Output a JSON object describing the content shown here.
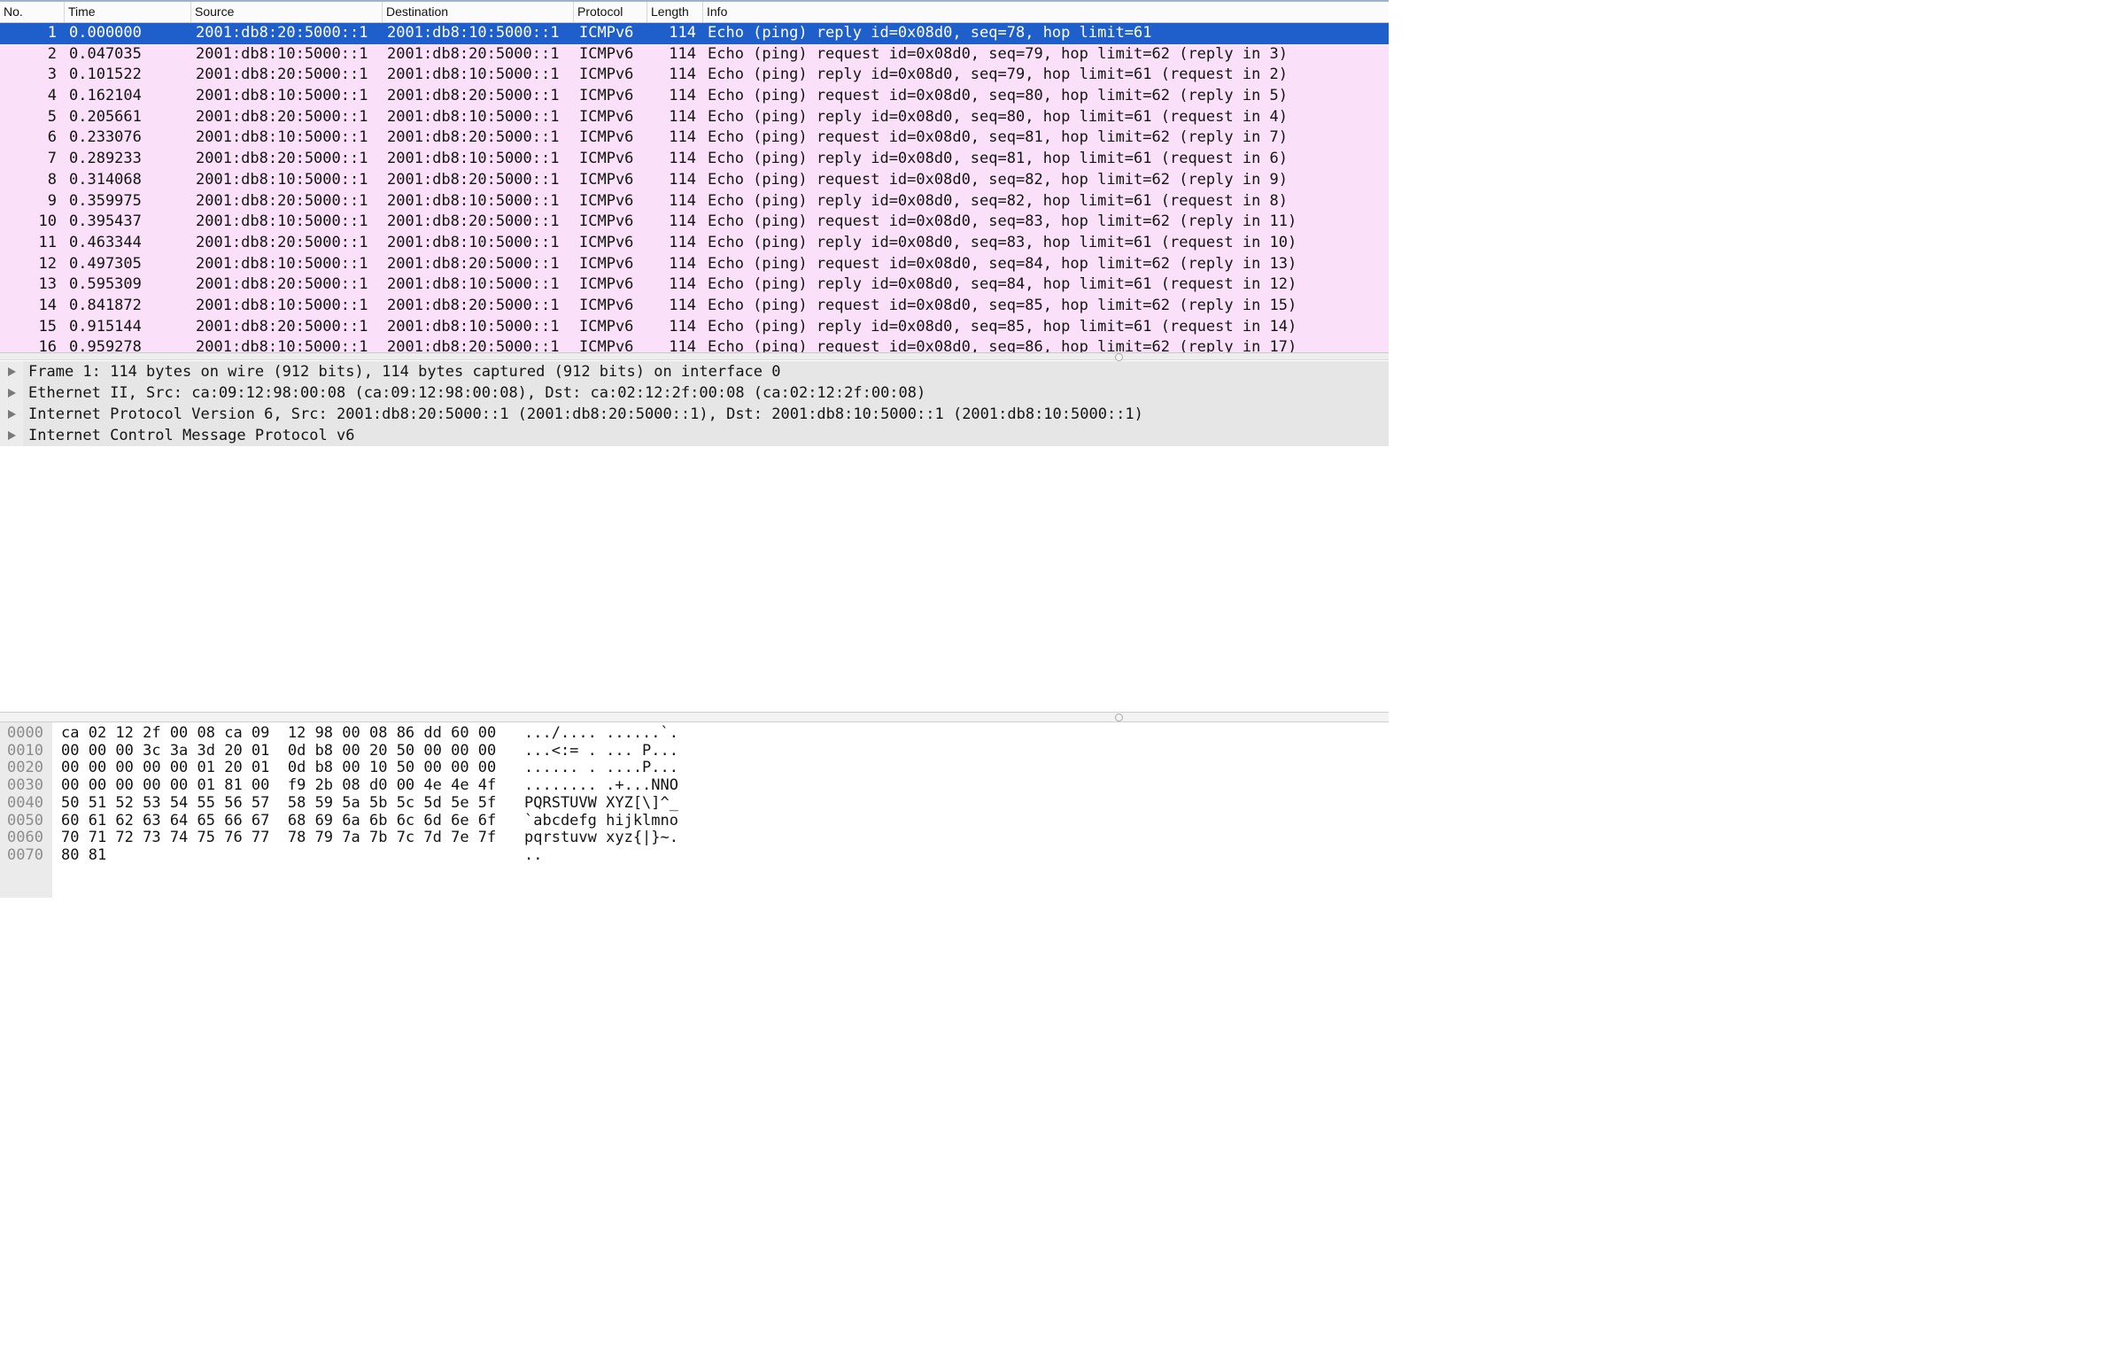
{
  "columns": {
    "no": "No.",
    "time": "Time",
    "source": "Source",
    "destination": "Destination",
    "protocol": "Protocol",
    "length": "Length",
    "info": "Info"
  },
  "packets": [
    {
      "no": "1",
      "time": "0.000000",
      "src": "2001:db8:20:5000::1",
      "dst": "2001:db8:10:5000::1",
      "proto": "ICMPv6",
      "len": "114",
      "info": "Echo (ping) reply id=0x08d0, seq=78, hop limit=61"
    },
    {
      "no": "2",
      "time": "0.047035",
      "src": "2001:db8:10:5000::1",
      "dst": "2001:db8:20:5000::1",
      "proto": "ICMPv6",
      "len": "114",
      "info": "Echo (ping) request id=0x08d0, seq=79, hop limit=62 (reply in 3)"
    },
    {
      "no": "3",
      "time": "0.101522",
      "src": "2001:db8:20:5000::1",
      "dst": "2001:db8:10:5000::1",
      "proto": "ICMPv6",
      "len": "114",
      "info": "Echo (ping) reply id=0x08d0, seq=79, hop limit=61 (request in 2)"
    },
    {
      "no": "4",
      "time": "0.162104",
      "src": "2001:db8:10:5000::1",
      "dst": "2001:db8:20:5000::1",
      "proto": "ICMPv6",
      "len": "114",
      "info": "Echo (ping) request id=0x08d0, seq=80, hop limit=62 (reply in 5)"
    },
    {
      "no": "5",
      "time": "0.205661",
      "src": "2001:db8:20:5000::1",
      "dst": "2001:db8:10:5000::1",
      "proto": "ICMPv6",
      "len": "114",
      "info": "Echo (ping) reply id=0x08d0, seq=80, hop limit=61 (request in 4)"
    },
    {
      "no": "6",
      "time": "0.233076",
      "src": "2001:db8:10:5000::1",
      "dst": "2001:db8:20:5000::1",
      "proto": "ICMPv6",
      "len": "114",
      "info": "Echo (ping) request id=0x08d0, seq=81, hop limit=62 (reply in 7)"
    },
    {
      "no": "7",
      "time": "0.289233",
      "src": "2001:db8:20:5000::1",
      "dst": "2001:db8:10:5000::1",
      "proto": "ICMPv6",
      "len": "114",
      "info": "Echo (ping) reply id=0x08d0, seq=81, hop limit=61 (request in 6)"
    },
    {
      "no": "8",
      "time": "0.314068",
      "src": "2001:db8:10:5000::1",
      "dst": "2001:db8:20:5000::1",
      "proto": "ICMPv6",
      "len": "114",
      "info": "Echo (ping) request id=0x08d0, seq=82, hop limit=62 (reply in 9)"
    },
    {
      "no": "9",
      "time": "0.359975",
      "src": "2001:db8:20:5000::1",
      "dst": "2001:db8:10:5000::1",
      "proto": "ICMPv6",
      "len": "114",
      "info": "Echo (ping) reply id=0x08d0, seq=82, hop limit=61 (request in 8)"
    },
    {
      "no": "10",
      "time": "0.395437",
      "src": "2001:db8:10:5000::1",
      "dst": "2001:db8:20:5000::1",
      "proto": "ICMPv6",
      "len": "114",
      "info": "Echo (ping) request id=0x08d0, seq=83, hop limit=62 (reply in 11)"
    },
    {
      "no": "11",
      "time": "0.463344",
      "src": "2001:db8:20:5000::1",
      "dst": "2001:db8:10:5000::1",
      "proto": "ICMPv6",
      "len": "114",
      "info": "Echo (ping) reply id=0x08d0, seq=83, hop limit=61 (request in 10)"
    },
    {
      "no": "12",
      "time": "0.497305",
      "src": "2001:db8:10:5000::1",
      "dst": "2001:db8:20:5000::1",
      "proto": "ICMPv6",
      "len": "114",
      "info": "Echo (ping) request id=0x08d0, seq=84, hop limit=62 (reply in 13)"
    },
    {
      "no": "13",
      "time": "0.595309",
      "src": "2001:db8:20:5000::1",
      "dst": "2001:db8:10:5000::1",
      "proto": "ICMPv6",
      "len": "114",
      "info": "Echo (ping) reply id=0x08d0, seq=84, hop limit=61 (request in 12)"
    },
    {
      "no": "14",
      "time": "0.841872",
      "src": "2001:db8:10:5000::1",
      "dst": "2001:db8:20:5000::1",
      "proto": "ICMPv6",
      "len": "114",
      "info": "Echo (ping) request id=0x08d0, seq=85, hop limit=62 (reply in 15)"
    },
    {
      "no": "15",
      "time": "0.915144",
      "src": "2001:db8:20:5000::1",
      "dst": "2001:db8:10:5000::1",
      "proto": "ICMPv6",
      "len": "114",
      "info": "Echo (ping) reply id=0x08d0, seq=85, hop limit=61 (request in 14)"
    },
    {
      "no": "16",
      "time": "0.959278",
      "src": "2001:db8:10:5000::1",
      "dst": "2001:db8:20:5000::1",
      "proto": "ICMPv6",
      "len": "114",
      "info": "Echo (ping) request id=0x08d0, seq=86, hop limit=62 (reply in 17)"
    }
  ],
  "selected_packet": "1",
  "details": [
    "Frame 1: 114 bytes on wire (912 bits), 114 bytes captured (912 bits) on interface 0",
    "Ethernet II, Src: ca:09:12:98:00:08 (ca:09:12:98:00:08), Dst: ca:02:12:2f:00:08 (ca:02:12:2f:00:08)",
    "Internet Protocol Version 6, Src: 2001:db8:20:5000::1 (2001:db8:20:5000::1), Dst: 2001:db8:10:5000::1 (2001:db8:10:5000::1)",
    "Internet Control Message Protocol v6"
  ],
  "bytes": [
    {
      "offset": "0000",
      "hex": "ca 02 12 2f 00 08 ca 09  12 98 00 08 86 dd 60 00",
      "ascii": ".../.... ......`."
    },
    {
      "offset": "0010",
      "hex": "00 00 00 3c 3a 3d 20 01  0d b8 00 20 50 00 00 00",
      "ascii": "...<:= . ... P..."
    },
    {
      "offset": "0020",
      "hex": "00 00 00 00 00 01 20 01  0d b8 00 10 50 00 00 00",
      "ascii": "...... . ....P..."
    },
    {
      "offset": "0030",
      "hex": "00 00 00 00 00 01 81 00  f9 2b 08 d0 00 4e 4e 4f",
      "ascii": "........ .+...NNO"
    },
    {
      "offset": "0040",
      "hex": "50 51 52 53 54 55 56 57  58 59 5a 5b 5c 5d 5e 5f",
      "ascii": "PQRSTUVW XYZ[\\]^_"
    },
    {
      "offset": "0050",
      "hex": "60 61 62 63 64 65 66 67  68 69 6a 6b 6c 6d 6e 6f",
      "ascii": "`abcdefg hijklmno"
    },
    {
      "offset": "0060",
      "hex": "70 71 72 73 74 75 76 77  78 79 7a 7b 7c 7d 7e 7f",
      "ascii": "pqrstuvw xyz{|}~."
    },
    {
      "offset": "0070",
      "hex": "80 81",
      "ascii": ".."
    }
  ],
  "colors": {
    "row_icmp_bg": "#fae0f8",
    "row_selected_bg": "#1f5fcc",
    "details_bg": "#e6e6e6",
    "offset_text": "#8c8c8c"
  },
  "icons": {
    "expand": "triangle-right-icon",
    "splitter": "splitter-handle-icon"
  }
}
